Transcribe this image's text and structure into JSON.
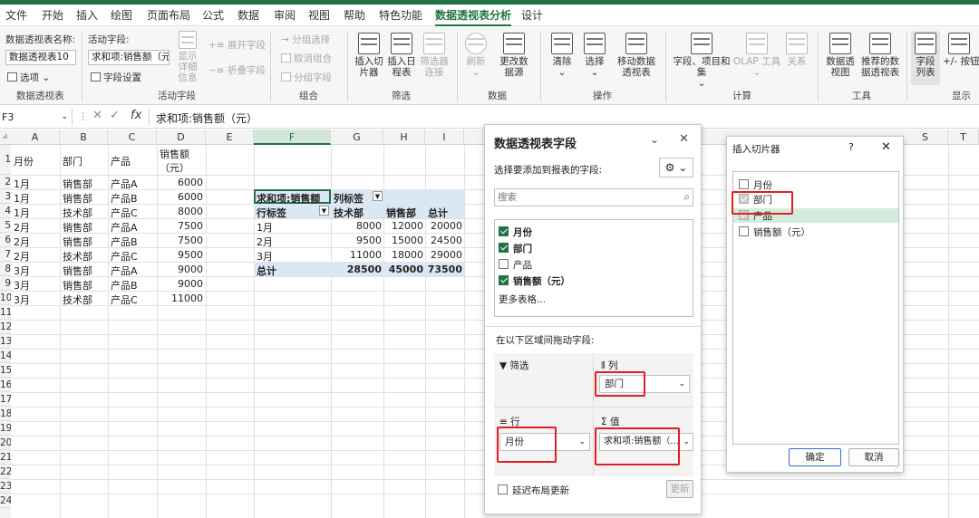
{
  "menu": [
    "文件",
    "开始",
    "插入",
    "绘图",
    "页面布局",
    "公式",
    "数据",
    "审阅",
    "视图",
    "帮助",
    "特色功能",
    "数据透视表分析",
    "设计"
  ],
  "ribbon": {
    "pivot_name_label": "数据透视表名称:",
    "pivot_name_value": "数据透视表10",
    "options_label": "选项",
    "group_pivottable": "数据透视表",
    "active_field_label": "活动字段:",
    "active_field_value": "求和项:销售额（元）",
    "field_settings": "字段设置",
    "drill_down": "显示详细信息",
    "expand_field": "展开字段",
    "collapse_field": "折叠字段",
    "group_active_field": "活动字段",
    "group_selection": "分组选择",
    "ungroup": "取消组合",
    "group_field": "分组字段",
    "group_group": "组合",
    "insert_slicer": "插入切片器",
    "insert_timeline": "插入日程表",
    "filter_connections": "筛选器连接",
    "group_filter": "筛选",
    "refresh": "刷新",
    "change_source": "更改数据源",
    "group_data": "数据",
    "clear": "清除",
    "select": "选择",
    "move_pivot": "移动数据透视表",
    "group_actions": "操作",
    "fields_items_sets": "字段、项目和集",
    "olap_tools": "OLAP 工具",
    "relationships": "关系",
    "group_calc": "计算",
    "pivot_chart": "数据透视图",
    "recommended": "推荐的数据透视表",
    "group_tools": "工具",
    "field_list": "字段列表",
    "plus_minus": "+/- 按钮",
    "group_show": "显示"
  },
  "formula": {
    "cell": "F3",
    "content": "求和项:销售额（元）"
  },
  "columns": [
    "A",
    "B",
    "C",
    "D",
    "E",
    "F",
    "G",
    "H",
    "I",
    "J",
    "K",
    "L",
    "M",
    "N",
    "O",
    "P",
    "Q",
    "R",
    "S",
    "T"
  ],
  "rows": [
    "1",
    "2",
    "3",
    "4",
    "5",
    "6",
    "7",
    "8",
    "9",
    "10",
    "11",
    "12",
    "13",
    "14",
    "15",
    "16",
    "17",
    "18",
    "19",
    "20",
    "21",
    "22",
    "23",
    "24"
  ],
  "source_table": {
    "headers": [
      "月份",
      "部门",
      "产品",
      "销售额",
      "（元）"
    ],
    "data": [
      [
        "1月",
        "销售部",
        "产品A",
        "6000"
      ],
      [
        "1月",
        "销售部",
        "产品B",
        "6000"
      ],
      [
        "1月",
        "技术部",
        "产品C",
        "8000"
      ],
      [
        "2月",
        "销售部",
        "产品A",
        "7500"
      ],
      [
        "2月",
        "销售部",
        "产品B",
        "7500"
      ],
      [
        "2月",
        "技术部",
        "产品C",
        "9500"
      ],
      [
        "3月",
        "销售部",
        "产品A",
        "9000"
      ],
      [
        "3月",
        "销售部",
        "产品B",
        "9000"
      ],
      [
        "3月",
        "技术部",
        "产品C",
        "11000"
      ]
    ]
  },
  "pivot": {
    "value_header": "求和项:销售额",
    "col_label": "列标签",
    "row_label": "行标签",
    "col_items": [
      "技术部",
      "销售部",
      "总计"
    ],
    "rows": [
      [
        "1月",
        "8000",
        "12000",
        "20000"
      ],
      [
        "2月",
        "9500",
        "15000",
        "24500"
      ],
      [
        "3月",
        "11000",
        "18000",
        "29000"
      ]
    ],
    "total": [
      "总计",
      "28500",
      "45000",
      "73500"
    ]
  },
  "field_pane": {
    "title": "数据透视表字段",
    "choose_label": "选择要添加到报表的字段:",
    "search_placeholder": "搜索",
    "fields": [
      {
        "name": "月份",
        "checked": true
      },
      {
        "name": "部门",
        "checked": true
      },
      {
        "name": "产品",
        "checked": false
      },
      {
        "name": "销售额（元）",
        "checked": true
      }
    ],
    "more_tables": "更多表格...",
    "drag_label": "在以下区域间拖动字段:",
    "area_filter": "筛选",
    "area_columns": "列",
    "area_rows": "行",
    "area_values": "值",
    "column_field": "部门",
    "row_field": "月份",
    "value_field": "求和项:销售额（...",
    "defer_update": "延迟布局更新",
    "update_btn": "更新"
  },
  "slicer_dialog": {
    "title": "插入切片器",
    "help": "?",
    "items": [
      {
        "name": "月份",
        "state": "off"
      },
      {
        "name": "部门",
        "state": "on"
      },
      {
        "name": "产品",
        "state": "on"
      },
      {
        "name": "销售额（元）",
        "state": "off"
      }
    ],
    "ok": "确定",
    "cancel": "取消"
  }
}
